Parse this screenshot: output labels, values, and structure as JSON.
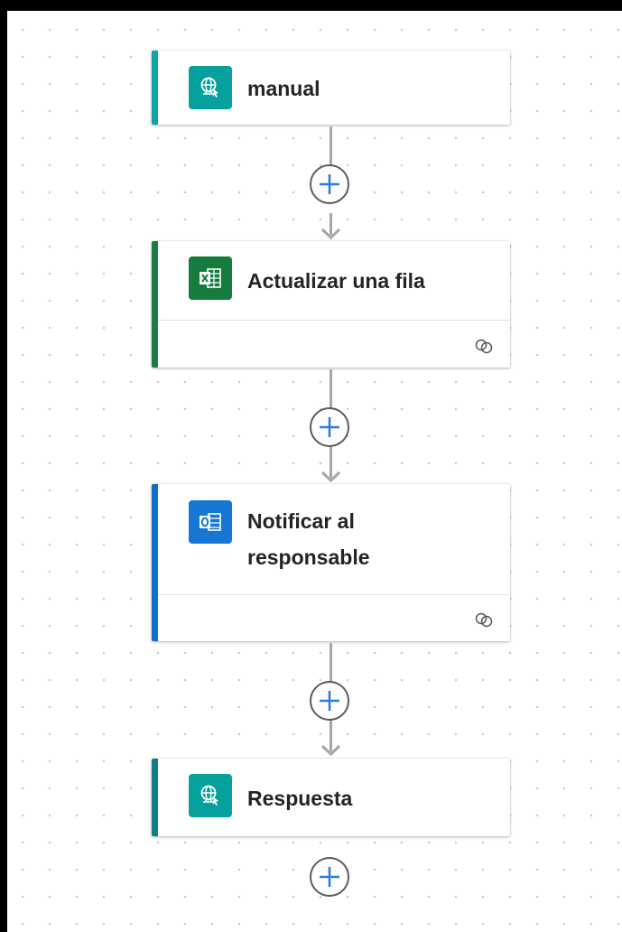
{
  "flow": {
    "steps": [
      {
        "title": "manual",
        "icon": "request-globe-icon",
        "accent": "#0aa5a5",
        "tile": "#06a19c"
      },
      {
        "title": "Actualizar una fila",
        "icon": "excel-icon",
        "accent": "#1c7c43",
        "tile": "#157c3d"
      },
      {
        "title": "Notificar al responsable",
        "title_line1": "Notificar al",
        "title_line2": "responsable",
        "icon": "outlook-icon",
        "accent": "#0f6fd1",
        "tile": "#1576d4"
      },
      {
        "title": "Respuesta",
        "icon": "response-globe-icon",
        "accent": "#0f7e86",
        "tile": "#06a19c"
      }
    ],
    "add_step_icon": "plus-icon",
    "connection_icon": "link-icon",
    "connector_color": "#a6a6a6",
    "plus_color": "#2f7ddc"
  }
}
